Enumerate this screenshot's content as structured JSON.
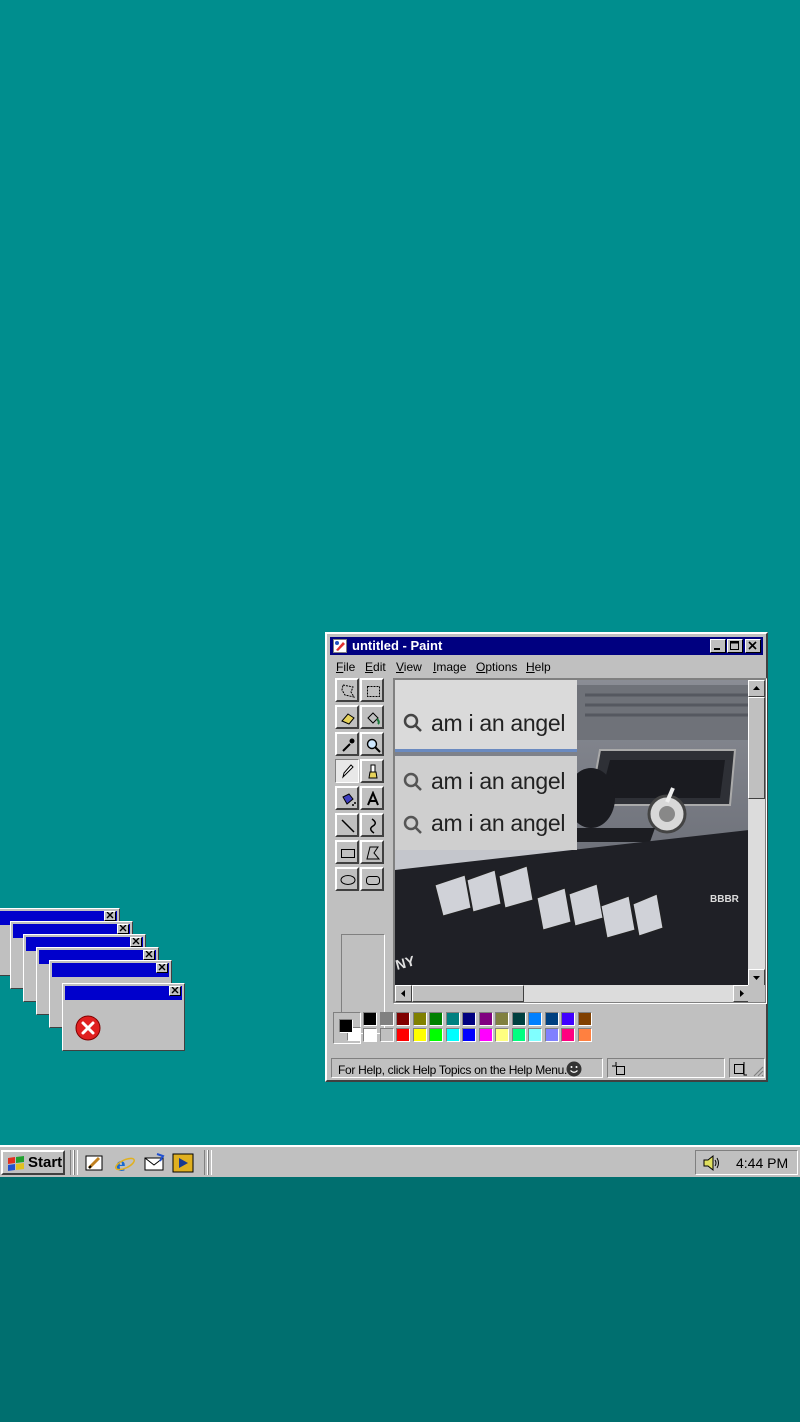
{
  "paint_window": {
    "title": "untitled - Paint",
    "menu": [
      "File",
      "Edit",
      "View",
      "Image",
      "Options",
      "Help"
    ],
    "tools": [
      "free-form-select",
      "select",
      "eraser",
      "fill-with-color",
      "pick-color",
      "magnifier",
      "pencil",
      "brush",
      "airbrush",
      "text",
      "line",
      "curve",
      "rectangle",
      "polygon",
      "ellipse",
      "rounded-rectangle"
    ],
    "canvas_image": {
      "search_query": "am i an angel",
      "suggestions": [
        "am i an angel",
        "am i an angel"
      ],
      "brand_fragment": "NY",
      "deck_label": "BBBR"
    },
    "status_text": "For Help, click Help Topics on the Help Menu.",
    "palette_top": [
      "#000000",
      "#808080",
      "#800000",
      "#808000",
      "#008000",
      "#008080",
      "#000080",
      "#800080",
      "#808040",
      "#004040",
      "#0080ff",
      "#004080",
      "#4000ff",
      "#804000"
    ],
    "palette_bottom": [
      "#ffffff",
      "#c0c0c0",
      "#ff0000",
      "#ffff00",
      "#00ff00",
      "#00ffff",
      "#0000ff",
      "#ff00ff",
      "#ffff80",
      "#00ff80",
      "#80ffff",
      "#8080ff",
      "#ff0080",
      "#ff8040"
    ],
    "foreground_color": "#000000",
    "background_color": "#ffffff"
  },
  "error_dialogs": {
    "count": 6,
    "icon": "error-x-icon"
  },
  "taskbar": {
    "start_label": "Start",
    "quick_launch": [
      "show-desktop-icon",
      "internet-explorer-icon",
      "outlook-express-icon",
      "media-player-icon"
    ],
    "tray_icon": "speaker-icon",
    "clock": "4:44 PM"
  }
}
